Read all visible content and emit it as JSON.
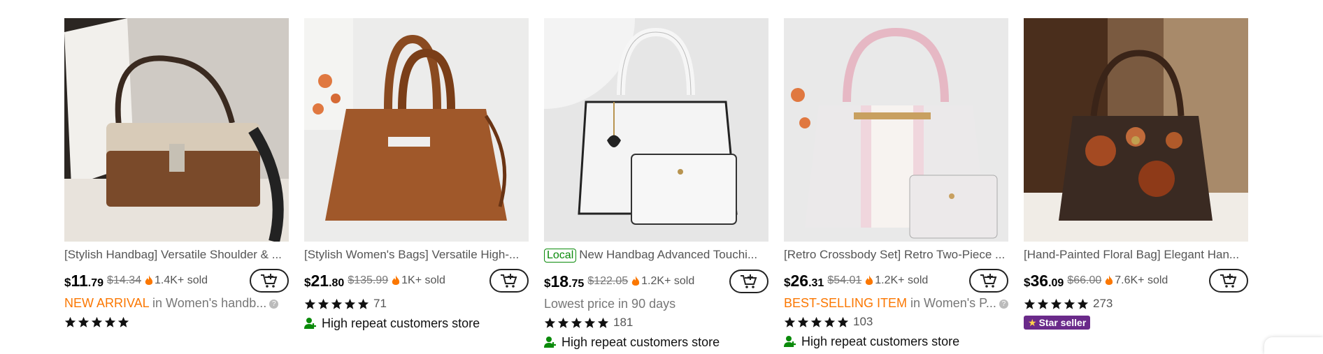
{
  "products": [
    {
      "title": "[Stylish Handbag] Versatile Shoulder & ...",
      "local": "",
      "price_currency": "$",
      "price_int": "11",
      "price_dec": ".79",
      "old_price": "$14.34",
      "sold": "1.4K+ sold",
      "badge": "NEW ARRIVAL",
      "badge_suffix": " in Women's handb...",
      "subtitle": "",
      "rating_count": "",
      "store": "",
      "star_seller": ""
    },
    {
      "title": "[Stylish Women's Bags] Versatile High-...",
      "local": "",
      "price_currency": "$",
      "price_int": "21",
      "price_dec": ".80",
      "old_price": "$135.99",
      "sold": "1K+ sold",
      "badge": "",
      "badge_suffix": "",
      "subtitle": "",
      "rating_count": "71",
      "store": "High repeat customers store",
      "star_seller": ""
    },
    {
      "title": "New Handbag Advanced Touchi...",
      "local": "Local",
      "price_currency": "$",
      "price_int": "18",
      "price_dec": ".75",
      "old_price": "$122.05",
      "sold": "1.2K+ sold",
      "badge": "",
      "badge_suffix": "",
      "subtitle": "Lowest price in 90 days",
      "rating_count": "181",
      "store": "High repeat customers store",
      "star_seller": ""
    },
    {
      "title": "[Retro Crossbody Set] Retro Two-Piece ...",
      "local": "",
      "price_currency": "$",
      "price_int": "26",
      "price_dec": ".31",
      "old_price": "$54.01",
      "sold": "1.2K+ sold",
      "badge": "BEST-SELLING ITEM",
      "badge_suffix": " in Women's P...",
      "subtitle": "",
      "rating_count": "103",
      "store": "High repeat customers store",
      "star_seller": ""
    },
    {
      "title": "[Hand-Painted Floral Bag] Elegant Han...",
      "local": "",
      "price_currency": "$",
      "price_int": "36",
      "price_dec": ".09",
      "old_price": "$66.00",
      "sold": "7.6K+ sold",
      "badge": "",
      "badge_suffix": "",
      "subtitle": "",
      "rating_count": "273",
      "store": "",
      "star_seller": "Star seller"
    }
  ],
  "colors": {
    "accent": "#fb7701",
    "store_green": "#0a8a0a",
    "star_seller_bg": "#6a2a8a"
  },
  "icons": {
    "cart": "add-to-cart-icon",
    "flame": "flame-icon",
    "star": "star-icon",
    "store": "users-icon"
  }
}
